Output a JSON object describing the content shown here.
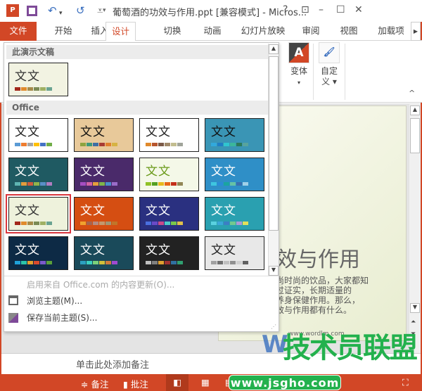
{
  "titlebar": {
    "title": "葡萄酒的功效与作用.ppt [兼容模式] - Micros...",
    "help": "?",
    "restore_ribbon": "⊡",
    "minimize": "–",
    "maximize": "☐",
    "close": "✕",
    "qa_undo": "↶",
    "qa_undo_arrow": "▾",
    "qa_redo": "↺",
    "qa_more": "⩡"
  },
  "tabs": [
    {
      "label": "文件"
    },
    {
      "label": "开始"
    },
    {
      "label": "插入"
    },
    {
      "label": "设计"
    },
    {
      "label": "切换"
    },
    {
      "label": "动画"
    },
    {
      "label": "幻灯片放映"
    },
    {
      "label": "审阅"
    },
    {
      "label": "视图"
    },
    {
      "label": "加载项"
    }
  ],
  "ribbon": {
    "variants_label": "变体",
    "customize_label_1": "自定",
    "customize_label_2": "义",
    "variants_icon_text": "A",
    "collapse": "^"
  },
  "dropdown": {
    "section_current": "此演示文稿",
    "section_office": "Office",
    "current_theme": {
      "text": "文文",
      "bg": "#f2f3e2",
      "fg": "#333",
      "palette": [
        "#a2281b",
        "#e08a2c",
        "#a58a4a",
        "#7b8a55",
        "#9fb063",
        "#6aa391"
      ]
    },
    "themes": [
      {
        "text": "文文",
        "bg": "#ffffff",
        "fg": "#222",
        "palette": [
          "#5b9bd5",
          "#ed7d31",
          "#a5a5a5",
          "#ffc000",
          "#4472c4",
          "#70ad47"
        ]
      },
      {
        "text": "文文",
        "bg": "#e8c99a",
        "fg": "#111",
        "palette": [
          "#8ea33f",
          "#3e9a79",
          "#3e6ea5",
          "#a83b33",
          "#e07f2e",
          "#d6b343"
        ]
      },
      {
        "text": "文文",
        "bg": "#ffffff",
        "fg": "#222",
        "palette": [
          "#e08a2c",
          "#b8562e",
          "#7b5a48",
          "#a18a6b",
          "#c2bd8f",
          "#a0a49a"
        ]
      },
      {
        "text": "文文",
        "bg": "#3a95b5",
        "fg": "#111",
        "palette": [
          "#31a9dc",
          "#1f7dc4",
          "#2fc5cf",
          "#3bb79b",
          "#2c7a5a",
          "#58a39d"
        ]
      },
      {
        "text": "文文",
        "bg": "#1f5a62",
        "fg": "#fff",
        "palette": [
          "#5fb5b2",
          "#e39c3d",
          "#cf5a3c",
          "#91b44a",
          "#5a8fc7",
          "#b07dc1"
        ]
      },
      {
        "text": "文文",
        "bg": "#4a2a6a",
        "fg": "#fff",
        "palette": [
          "#a64dc1",
          "#d462a5",
          "#e6a03b",
          "#7fb44a",
          "#4a8fcb",
          "#9a6cc9"
        ]
      },
      {
        "text": "文文",
        "bg": "#f4f8e8",
        "fg": "#6a9a1a",
        "palette": [
          "#90c226",
          "#54a021",
          "#e6b91e",
          "#e76618",
          "#c42f1a",
          "#918655"
        ]
      },
      {
        "text": "文文",
        "bg": "#2f8fc7",
        "fg": "#fff",
        "palette": [
          "#3ec6e0",
          "#2a8cd6",
          "#1aa5a0",
          "#66c2a5",
          "#3a6fb0",
          "#a0d0e8"
        ]
      },
      {
        "text": "文文",
        "bg": "#eef2dc",
        "fg": "#333",
        "palette": [
          "#a2281b",
          "#e08a2c",
          "#a58a4a",
          "#7b8a55",
          "#9fb063",
          "#6aa391"
        ]
      },
      {
        "text": "文文",
        "bg": "#d54e12",
        "fg": "#fff",
        "palette": [
          "#f0a22e",
          "#a5644e",
          "#b58b80",
          "#c3986d",
          "#a19574",
          "#c17529"
        ]
      },
      {
        "text": "文文",
        "bg": "#2a3080",
        "fg": "#fff",
        "palette": [
          "#4a6fe0",
          "#6a4ac8",
          "#c84a8a",
          "#4ac8c8",
          "#7ac84a",
          "#e0c04a"
        ]
      },
      {
        "text": "文文",
        "bg": "#2aa0b0",
        "fg": "#fff",
        "palette": [
          "#5ad1e0",
          "#3aa7d9",
          "#3b7fc4",
          "#73c98e",
          "#ac98d6",
          "#e0e05a"
        ]
      },
      {
        "text": "文文",
        "bg": "#0d2a45",
        "fg": "#fff",
        "palette": [
          "#1fa1d9",
          "#2cc4a8",
          "#e3a02c",
          "#d94a2c",
          "#7b5ac9",
          "#5aa03a"
        ]
      },
      {
        "text": "文文",
        "bg": "#1a4a5a",
        "fg": "#fff",
        "palette": [
          "#2ca0c0",
          "#3ad0c0",
          "#7ad07a",
          "#d0c03a",
          "#d07a3a",
          "#a04ad0"
        ]
      },
      {
        "text": "文文",
        "bg": "#222222",
        "fg": "#fff",
        "palette": [
          "#c0c0c0",
          "#808080",
          "#e0a030",
          "#a03030",
          "#3070a0",
          "#30a070"
        ]
      },
      {
        "text": "文文",
        "bg": "#e8e8e8",
        "fg": "#222",
        "palette": [
          "#a0a0a0",
          "#707070",
          "#c0c0c0",
          "#909090",
          "#d0d0d0",
          "#606060"
        ]
      }
    ],
    "menu_update": "启用来自 Office.com 的内容更新(O)...",
    "menu_browse": "浏览主题(M)...",
    "menu_save": "保存当前主题(S)..."
  },
  "slide": {
    "title": "效与作用",
    "body": [
      "尚时尚的饮品，大家都知",
      "过证实，长期适量的",
      "养身保健作用。那么，",
      "效与作用都有什么。"
    ]
  },
  "notes": {
    "placeholder": "单击此处添加备注"
  },
  "status": {
    "notes": "备注",
    "comments": "批注"
  },
  "watermark": {
    "site": "www.wordlm.com",
    "logo": "Word联盟",
    "brand": "技术员联盟",
    "url": "www.jsgho.com"
  },
  "colors": {
    "accent": "#d24726",
    "watermark_green": "#23b14d"
  }
}
